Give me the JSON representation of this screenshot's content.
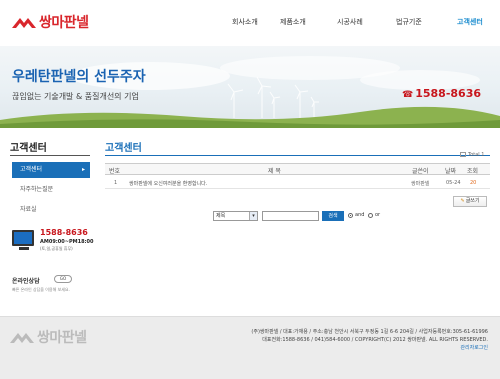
{
  "header": {
    "logo_text": "쌍마판넬",
    "nav": [
      "회사소개",
      "제품소개",
      "시공사례",
      "법규기준",
      "고객센터"
    ]
  },
  "banner": {
    "title": "우레탄판넬의 선두주자",
    "subtitle": "끊임없는 기술개발 & 품질개선의 기업",
    "phone": "1588-8636"
  },
  "sidebar": {
    "title": "고객센터",
    "items": [
      {
        "label": "고객센터"
      },
      {
        "label": "자주하는질문"
      },
      {
        "label": "자료실"
      }
    ],
    "contact": {
      "phone": "1588-8636",
      "hours": "AM09:00~PM18:00",
      "note": "(토,일,공휴일 휴무)"
    },
    "online": {
      "title": "온라인상담",
      "go": "GO",
      "desc": "빠른 온라인 상담을 이용해 보세요."
    }
  },
  "main": {
    "title": "고객센터",
    "total": "Total 1",
    "columns": [
      "번호",
      "제 목",
      "글쓴이",
      "날짜",
      "조회"
    ],
    "rows": [
      {
        "num": "1",
        "title": "쌍마판넬에 오신여러분을 환영합니다.",
        "author": "쌍마판넬",
        "date": "05-24",
        "hits": "20"
      }
    ],
    "write_label": "글쓰기",
    "search": {
      "select_value": "제목",
      "button": "검색",
      "radio_and": "and",
      "radio_or": "or"
    }
  },
  "footer": {
    "logo_text": "쌍마판넬",
    "line1": "(주)쌍마판넬 / 대표:가재용 / 주소:충남 천안시 서북구 두정동 1길 6-6 204길 / 사업자등록번호:305-61-61996",
    "line2": "대표전화:1588-8636 / 041)584-6000 / COPYRIGHT(C) 2012 쌍마판넬. ALL RIGHTS RESERVED.",
    "admin": "관리자로그인"
  },
  "colors": {
    "brand_red": "#d9262c",
    "accent_blue": "#1a6fb8",
    "nav_active": "#1a8ccf",
    "phone_red": "#c8161d"
  }
}
